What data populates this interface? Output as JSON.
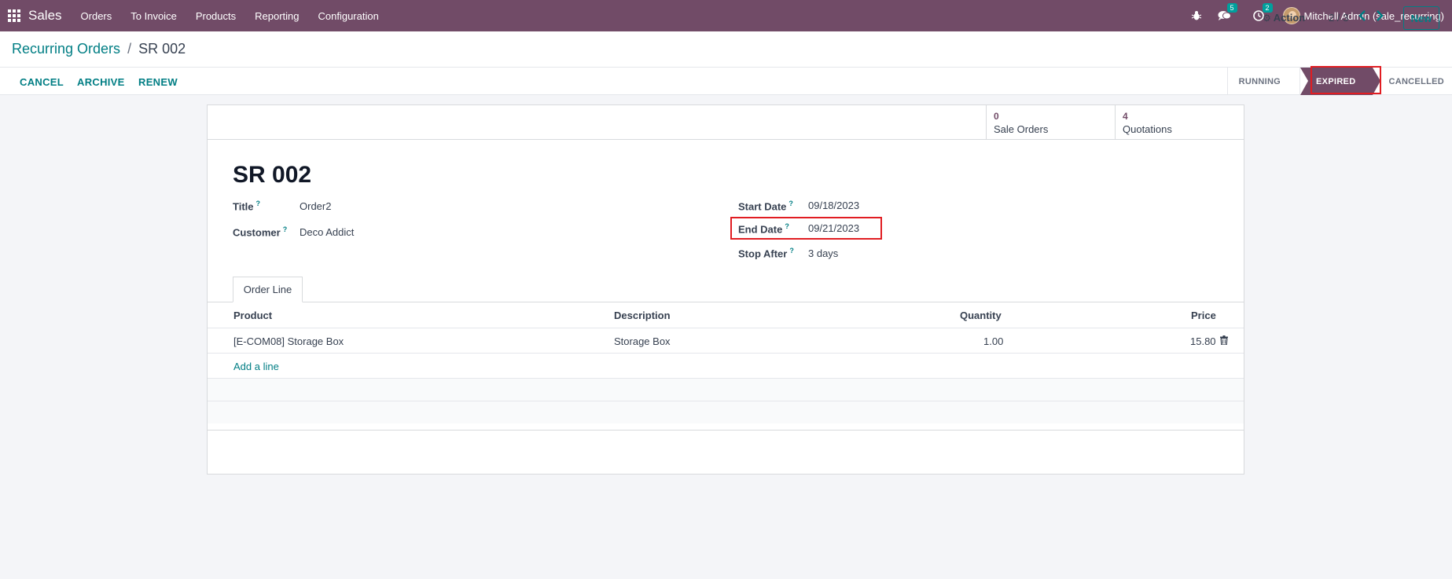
{
  "navbar": {
    "app_name": "Sales",
    "menu": [
      "Orders",
      "To Invoice",
      "Products",
      "Reporting",
      "Configuration"
    ],
    "messages_count": "5",
    "activities_count": "2",
    "user": "Mitchell Admin (sale_recurring)",
    "icons": [
      "apps-grid-icon",
      "bug-icon",
      "chat-icon",
      "clock-icon"
    ]
  },
  "control": {
    "breadcrumb_parent": "Recurring Orders",
    "breadcrumb_sep": "/",
    "breadcrumb_current": "SR 002",
    "action_label": "Action",
    "pager": "2 / 3",
    "new_label": "New"
  },
  "statusbar": {
    "buttons": [
      "CANCEL",
      "ARCHIVE",
      "RENEW"
    ],
    "stages": [
      "RUNNING",
      "EXPIRED",
      "CANCELLED"
    ],
    "active_stage": "EXPIRED"
  },
  "stats": [
    {
      "value": "0",
      "label": "Sale Orders"
    },
    {
      "value": "4",
      "label": "Quotations"
    }
  ],
  "form": {
    "title": "SR 002",
    "title_label": "Title",
    "title_value": "Order2",
    "customer_label": "Customer",
    "customer_value": "Deco Addict",
    "start_label": "Start Date",
    "start_value": "09/18/2023",
    "end_label": "End Date",
    "end_value": "09/21/2023",
    "stop_label": "Stop After",
    "stop_value": "3 days",
    "help_mark": "?"
  },
  "tab": "Order Line",
  "table": {
    "headers": [
      "Product",
      "Description",
      "Quantity",
      "Price"
    ],
    "rows": [
      {
        "product": "[E-COM08] Storage Box",
        "description": "Storage Box",
        "quantity": "1.00",
        "price": "15.80"
      }
    ],
    "add_line": "Add a line"
  },
  "colors": {
    "brand": "#714b67",
    "accent": "#017e84",
    "highlight": "#e11d22"
  }
}
